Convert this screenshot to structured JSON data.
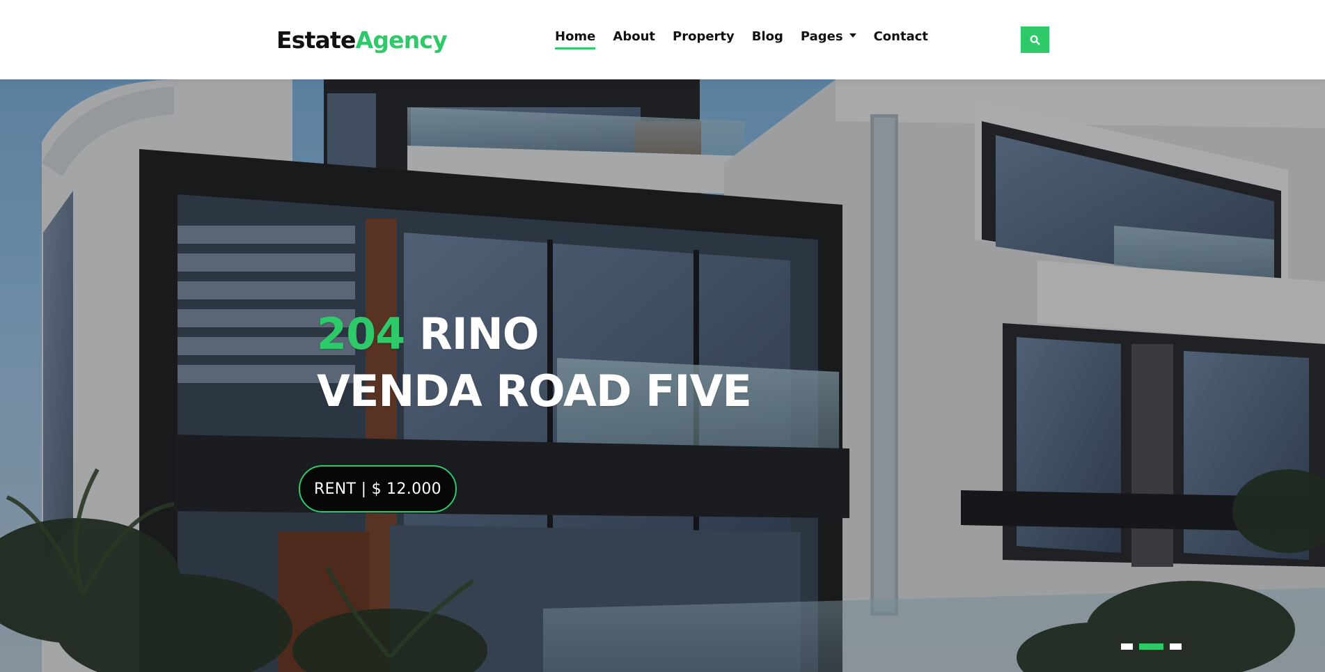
{
  "brand": {
    "part1": "Estate",
    "part2": "Agency"
  },
  "nav": {
    "items": [
      {
        "label": "Home"
      },
      {
        "label": "About"
      },
      {
        "label": "Property"
      },
      {
        "label": "Blog"
      },
      {
        "label": "Pages"
      },
      {
        "label": "Contact"
      }
    ],
    "active_label": "Home",
    "search_icon": "search-icon"
  },
  "hero": {
    "title_number": "204",
    "title_rest_line1": "RINO",
    "title_line2": "VENDA ROAD FIVE",
    "price_label": "RENT | $ 12.000",
    "slides_total": 3,
    "active_slide": 2
  },
  "colors": {
    "accent": "#2eca6a",
    "text_dark": "#111111",
    "white": "#ffffff"
  }
}
